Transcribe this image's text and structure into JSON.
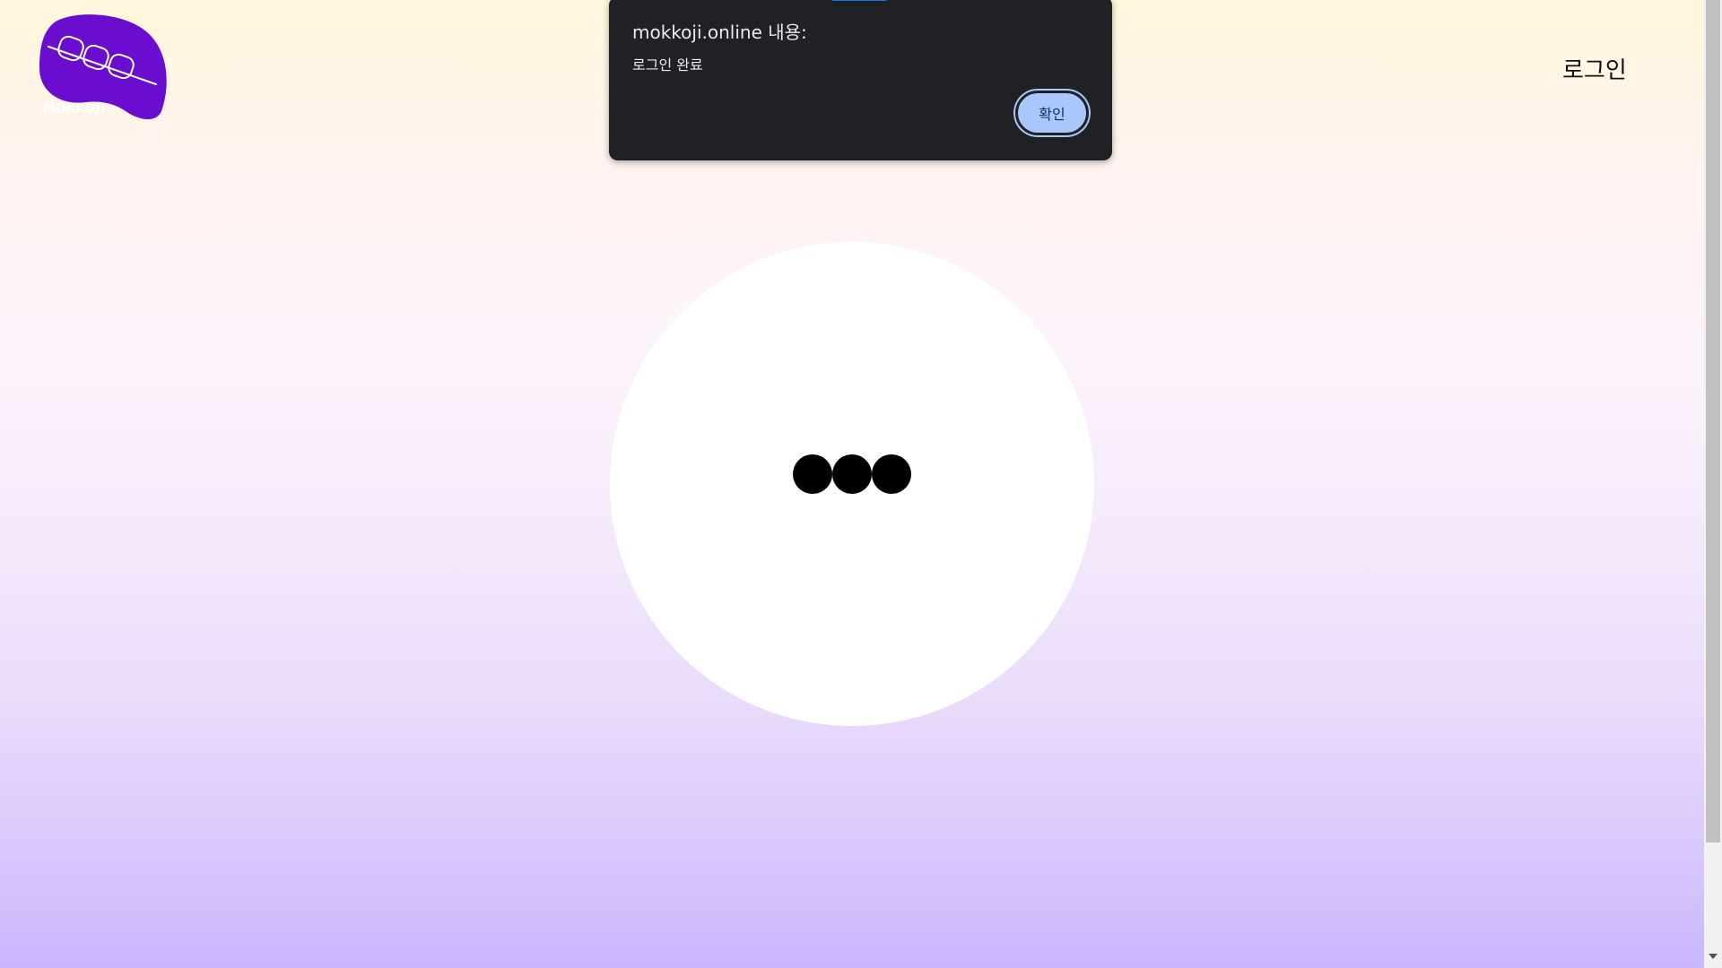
{
  "header": {
    "logo_text": "MOKKOJI",
    "login_label": "로그인"
  },
  "loader": {
    "dot_count": 3
  },
  "dialog": {
    "title": "mokkoji.online 내용:",
    "message": "로그인 완료",
    "ok_label": "확인"
  },
  "colors": {
    "brand": "#6a0dce",
    "dialog_bg": "#202124",
    "button_bg": "#a8c7fa"
  }
}
